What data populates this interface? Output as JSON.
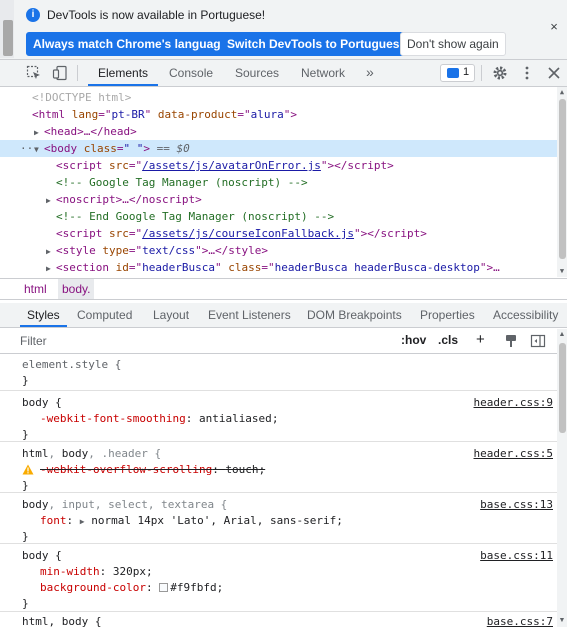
{
  "infobar": {
    "message": "DevTools is now available in Portuguese!",
    "btn_match": "Always match Chrome's language",
    "btn_switch": "Switch DevTools to Portuguese",
    "btn_dismiss": "Don't show again",
    "close": "×"
  },
  "toolbar": {
    "tabs": [
      "Elements",
      "Console",
      "Sources",
      "Network"
    ],
    "more": "»",
    "issues_count": "1"
  },
  "dom": {
    "doctype": "<!DOCTYPE html>",
    "html_open": {
      "tag": "html",
      "lang": "pt-BR",
      "product": "alura"
    },
    "head": "<head>…</head>",
    "body": {
      "dots": "···",
      "cls": "\" \"",
      "eq": "== $0"
    },
    "script1_src": "/assets/js/avatarOnError.js",
    "gtm_comment": "<!-- Google Tag Manager (noscript) -->",
    "noscript": "<noscript>…</noscript>",
    "gtm_end_comment": "<!-- End Google Tag Manager (noscript) -->",
    "script2_src": "/assets/js/courseIconFallback.js",
    "style_type": "text/css",
    "section_id": "headerBusca",
    "section_class": "headerBusca headerBusca-desktop"
  },
  "breadcrumb": [
    "html",
    "body."
  ],
  "styles_tabs": [
    "Styles",
    "Computed",
    "Layout",
    "Event Listeners",
    "DOM Breakpoints",
    "Properties",
    "Accessibility"
  ],
  "filter": {
    "placeholder": "Filter",
    "hov": ":hov",
    "cls": ".cls",
    "plus": "+"
  },
  "rules": [
    {
      "selector": "element.style {",
      "source": "",
      "decls": []
    },
    {
      "selector": "body {",
      "source": "header.css:9",
      "decls": [
        {
          "prop": "-webkit-font-smoothing",
          "val": "antialiased"
        }
      ]
    },
    {
      "selector": "html, body, .header {",
      "source": "header.css:5",
      "decls": [
        {
          "prop": "-webkit-overflow-scrolling",
          "val": "touch"
        }
      ]
    },
    {
      "selector": "body, input, select, textarea {",
      "source": "base.css:13",
      "decls": [
        {
          "prop": "font",
          "val": "normal 14px 'Lato', Arial, sans-serif"
        }
      ]
    },
    {
      "selector": "body {",
      "source": "base.css:11",
      "decls": [
        {
          "prop": "min-width",
          "val": "320px"
        },
        {
          "prop": "background-color",
          "val": "#f9fbfd"
        }
      ]
    },
    {
      "selector": "html, body {",
      "source": "base.css:7",
      "decls": []
    }
  ],
  "colors": {
    "accent": "#1a73e8",
    "bg_swatch": "#f9fbfd"
  }
}
